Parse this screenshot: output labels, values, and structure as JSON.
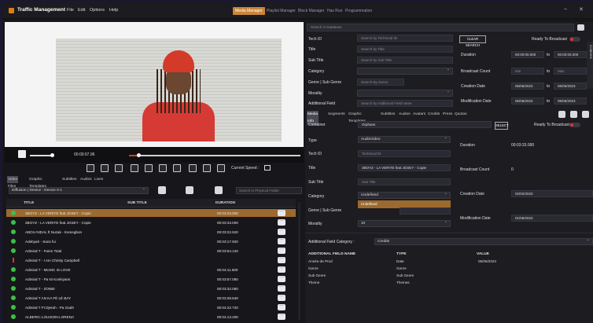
{
  "app": {
    "title": "Traffic Management",
    "menu": [
      "File",
      "Edit",
      "Options",
      "Help"
    ],
    "modes": [
      {
        "label": "Media Manager",
        "active": true
      },
      {
        "label": "Playlist Manager",
        "active": false
      },
      {
        "label": "Block Manager",
        "active": false
      },
      {
        "label": "Has Run",
        "active": false
      },
      {
        "label": "Programmation",
        "active": false
      }
    ],
    "win_min": "–",
    "win_close": "✕"
  },
  "player": {
    "timecode": "00:00:07.96",
    "progress_fraction": 0.05,
    "speed_label": "Current Speed :"
  },
  "left": {
    "subtabs": [
      "Video Files",
      "Graphic Templates",
      "Subtitles",
      "Audios",
      "Lives"
    ],
    "diffusion_select": "Diffusion | Device : Device 0-1",
    "search_placeholder": "Search in Physical Folder",
    "columns": [
      "TITLE",
      "SUB TITLE",
      "DURATION"
    ],
    "rows": [
      {
        "title": "2BOYZ - LA VERITE feat JOSEY - Copie",
        "duration": "00:03:33.000",
        "selected": true,
        "status": "ok"
      },
      {
        "title": "2BOYZ - LA VERITE feat JOSEY - Copie",
        "duration": "00:03:33.000",
        "selected": false,
        "status": "ok"
      },
      {
        "title": "ABOU NIDAL ft Nuzak - Komegbon",
        "duration": "00:03:22.520",
        "selected": false,
        "status": "ok"
      },
      {
        "title": "Adebyah - Sans fui",
        "duration": "00:03:17.920",
        "selected": false,
        "status": "ok"
      },
      {
        "title": "Admiral T - Fanm Total",
        "duration": "00:03:54.120",
        "selected": false,
        "status": "ok"
      },
      {
        "title": "Admiral T - I Am Christy Campbell",
        "duration": "",
        "selected": false,
        "status": "warn"
      },
      {
        "title": "Admiral T - MUSIC IS LOVE",
        "duration": "00:04:11.600",
        "selected": false,
        "status": "ok"
      },
      {
        "title": "Admiral T - Pa Ni Konkiyans",
        "duration": "00:03:57.080",
        "selected": false,
        "status": "ok"
      },
      {
        "title": "Admiral T - ZONBI",
        "duration": "00:03:32.080",
        "selected": false,
        "status": "ok"
      },
      {
        "title": "Admiral T AN KA FÈ LÈ BAY",
        "duration": "00:03:39.640",
        "selected": false,
        "status": "ok"
      },
      {
        "title": "Admiral T Ft Djerah - Pa Gadé",
        "duration": "00:04:22.720",
        "selected": false,
        "status": "ok"
      },
      {
        "title": "ALBERIC LOUISON-LORENA",
        "duration": "00:04:13.200",
        "selected": false,
        "status": "ok"
      }
    ]
  },
  "search": {
    "header_placeholder": "Search in Database",
    "tech_id_label": "Tech ID",
    "tech_id_ph": "Search by Technical ID",
    "title_label": "Title",
    "title_ph": "Search by Title",
    "subtitle_label": "Sub Title",
    "subtitle_ph": "Search by Sub Title",
    "category_label": "Category",
    "genre_label": "Genre | Sub Genre",
    "genre_ph": "Search By Genre",
    "morality_label": "Morality",
    "addfield_label": "Additional Field",
    "addfield_ph": "Search by Additional Field name",
    "clear_label": "CLEAR SEARCH",
    "ready_label": "Ready To Broadcast",
    "duration_label": "Duration",
    "duration_from": "00:00:00.000",
    "duration_to": "00:00:00.000",
    "bcount_label": "Broadcast Count",
    "min_ph": "Min",
    "max_ph": "Max",
    "creation_label": "Creation Date",
    "creation_from": "06/06/2023",
    "creation_to": "06/06/2023",
    "mod_label": "Modification Date",
    "mod_from": "06/06/2023",
    "mod_to": "06/06/2023",
    "to_label": "to",
    "side_label": "Columns"
  },
  "media": {
    "tabs": [
      "Media Info",
      "Segments",
      "Graphic Templates",
      "Subtitles",
      "Audios",
      "Avatars",
      "Credits",
      "Press",
      "Quotas"
    ],
    "container_label": "Container",
    "container_value": "Orphans",
    "select_label": "SELECT",
    "ready_label": "Ready To Broadcast",
    "type_label": "Type",
    "type_value": "AudioVideo",
    "techid_label": "Tech ID",
    "techid_ph": "Technical ID",
    "title_label": "Title",
    "title_value": "2BOYZ - LA VERITE feat JOSEY - Copie",
    "subtitle_label": "Sub Title",
    "subtitle_ph": "Sub Title",
    "category_label": "Category",
    "category_value": "Undefined",
    "dropdown_item": "Undefined",
    "genre_label": "Genre | Sub Genre",
    "morality_label": "Morality",
    "morality_value": "10",
    "duration_label": "Duration",
    "duration_value": "00:03:33.000",
    "bcount_label": "Broadcast Count",
    "bcount_value": "0",
    "creation_label": "Creation Date",
    "creation_value": "02/02/2023",
    "mod_label": "Modification Date",
    "mod_value": "01/06/2023",
    "addcat_label": "Additional Field Category :",
    "addcat_value": "Credits",
    "fields_columns": [
      "ADDITIONAL FIELD NAME",
      "TYPE",
      "VALUE"
    ],
    "fields_rows": [
      {
        "name": "Année de Prod",
        "type": "Date",
        "value": "06/06/2023"
      },
      {
        "name": "Genre",
        "type": "Genre",
        "value": ""
      },
      {
        "name": "Sub Genre",
        "type": "Sub Genre",
        "value": ""
      },
      {
        "name": "Theme",
        "type": "Themes",
        "value": ""
      }
    ]
  }
}
